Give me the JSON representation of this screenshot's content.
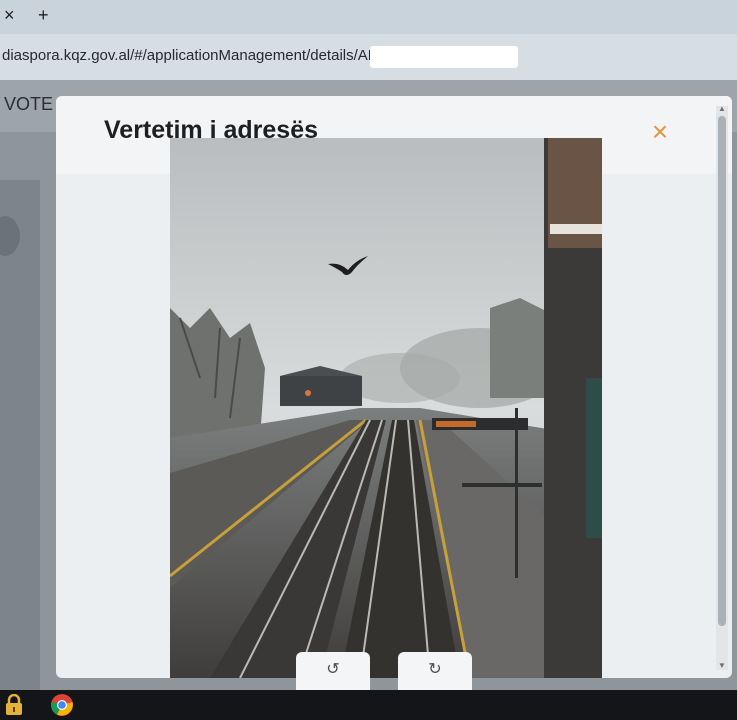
{
  "browser": {
    "close_tab_glyph": "×",
    "new_tab_glyph": "+",
    "url": "diaspora.kqz.gov.al/#/applicationManagement/details/APP-"
  },
  "page": {
    "header_text": "VOTE"
  },
  "modal": {
    "title": "Vertetim i adresës",
    "close_glyph": "×",
    "rotate_left_glyph": "↺",
    "rotate_right_glyph": "↻",
    "accent_color": "#e19640"
  },
  "taskbar": {
    "icons": [
      "lock-icon",
      "chrome-icon"
    ]
  }
}
